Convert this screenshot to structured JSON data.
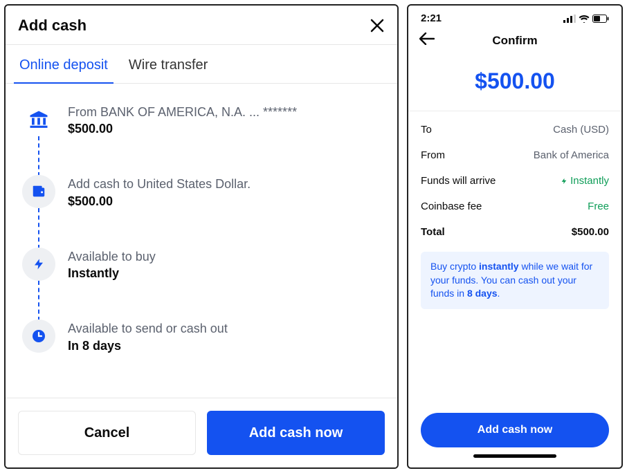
{
  "left": {
    "title": "Add cash",
    "tabs": {
      "online": "Online deposit",
      "wire": "Wire transfer"
    },
    "step1_label": "From BANK OF AMERICA, N.A. ... *******",
    "step1_amount": "$500.00",
    "step2_label": "Add cash to United States Dollar.",
    "step2_amount": "$500.00",
    "step3_label": "Available to buy",
    "step3_value": "Instantly",
    "step4_label": "Available to send or cash out",
    "step4_value": "In 8 days",
    "cancel": "Cancel",
    "addcash": "Add cash now"
  },
  "right": {
    "clock": "2:21",
    "title": "Confirm",
    "amount": "$500.00",
    "to_k": "To",
    "to_v": "Cash (USD)",
    "from_k": "From",
    "from_v": "Bank of America",
    "arrive_k": "Funds will arrive",
    "arrive_v": "Instantly",
    "fee_k": "Coinbase fee",
    "fee_v": "Free",
    "total_k": "Total",
    "total_v": "$500.00",
    "info_pre": "Buy crypto ",
    "info_b1": "instantly",
    "info_mid": " while we wait for your funds. You can cash out your funds in ",
    "info_b2": "8 days",
    "info_suf": ".",
    "cta": "Add cash now"
  }
}
